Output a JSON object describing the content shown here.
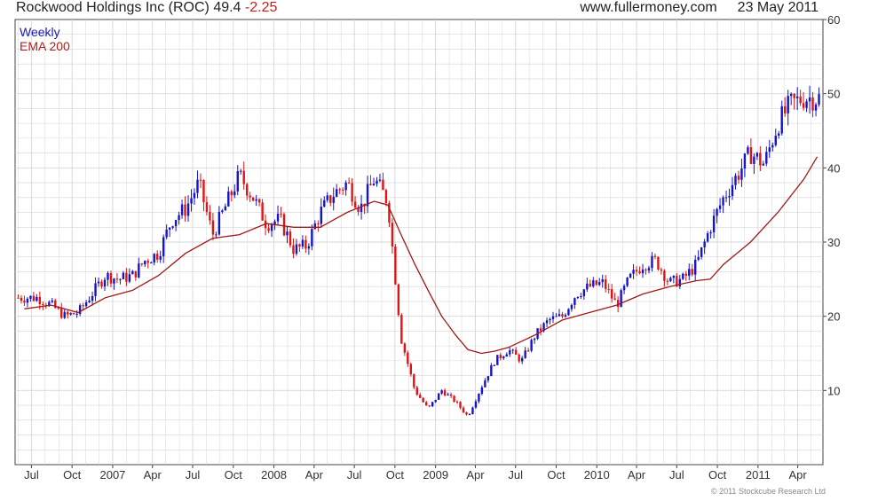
{
  "header": {
    "ticker_name": "Rockwood Holdings Inc (ROC)",
    "last_price": "49.4",
    "change": "-2.25",
    "website": "www.fullermoney.com",
    "date": "23 May 2011"
  },
  "legend": {
    "series_label": "Weekly",
    "ema_label": "EMA 200"
  },
  "credit": "© 2011 Stockcube Research Ltd",
  "colors": {
    "up_candle": "#1414c8",
    "down_candle": "#e01414",
    "ema_line": "#a01818",
    "grid": "#d6d6d6",
    "legend_weekly": "#1a1ab0",
    "legend_ema": "#b02020"
  },
  "chart_data": {
    "type": "line",
    "title": "Rockwood Holdings Inc (ROC) 49.4 -2.25",
    "subtitle": "Weekly",
    "xlabel": "",
    "ylabel": "",
    "ylim": [
      0,
      60
    ],
    "yticks": [
      10,
      20,
      30,
      40,
      50,
      60
    ],
    "x_tick_labels": [
      "Jul",
      "Oct",
      "2007",
      "Apr",
      "Jul",
      "Oct",
      "2008",
      "Apr",
      "Jul",
      "Oct",
      "2009",
      "Apr",
      "Jul",
      "Oct",
      "2010",
      "Apr",
      "Jul",
      "Oct",
      "2011",
      "Apr"
    ],
    "y_axis_side": "right",
    "grid": true,
    "legend_position": "top-left",
    "series": [
      {
        "name": "Weekly",
        "style": "candlestick",
        "x": [
          "2006-06",
          "2006-07",
          "2006-08",
          "2006-09",
          "2006-10",
          "2006-11",
          "2006-12",
          "2007-01",
          "2007-02",
          "2007-03",
          "2007-04",
          "2007-05",
          "2007-06",
          "2007-07",
          "2007-08",
          "2007-09",
          "2007-10",
          "2007-11",
          "2007-12",
          "2008-01",
          "2008-02",
          "2008-03",
          "2008-04",
          "2008-05",
          "2008-06",
          "2008-07",
          "2008-08",
          "2008-09",
          "2008-10",
          "2008-11",
          "2008-12",
          "2009-01",
          "2009-02",
          "2009-03",
          "2009-04",
          "2009-05",
          "2009-06",
          "2009-07",
          "2009-08",
          "2009-09",
          "2009-10",
          "2009-11",
          "2009-12",
          "2010-01",
          "2010-02",
          "2010-03",
          "2010-04",
          "2010-05",
          "2010-06",
          "2010-07",
          "2010-08",
          "2010-09",
          "2010-10",
          "2010-11",
          "2010-12",
          "2011-01",
          "2011-02",
          "2011-03",
          "2011-04",
          "2011-05"
        ],
        "values": [
          22.5,
          22.5,
          21.5,
          20,
          20.5,
          23,
          25.5,
          25,
          25.5,
          27.5,
          28.5,
          33,
          34.5,
          38,
          31,
          35,
          39,
          36,
          32.5,
          33,
          29,
          29.5,
          34,
          36.5,
          38,
          34.5,
          38.5,
          35.5,
          17,
          10,
          7.5,
          10,
          8.5,
          6.5,
          10.5,
          14,
          15.5,
          14,
          17.5,
          19.5,
          20,
          23,
          24,
          24.5,
          21.5,
          25,
          27,
          27.5,
          24.5,
          25,
          27,
          32,
          36,
          39,
          42,
          40.5,
          46,
          48.5,
          49.5,
          49.4
        ]
      },
      {
        "name": "EMA 200",
        "style": "line",
        "x": [
          "2006-06",
          "2006-08",
          "2006-10",
          "2006-12",
          "2007-02",
          "2007-04",
          "2007-06",
          "2007-08",
          "2007-10",
          "2007-12",
          "2008-02",
          "2008-04",
          "2008-06",
          "2008-08",
          "2008-09",
          "2008-10",
          "2008-11",
          "2008-12",
          "2009-01",
          "2009-02",
          "2009-03",
          "2009-04",
          "2009-05",
          "2009-06",
          "2009-08",
          "2009-10",
          "2009-12",
          "2010-02",
          "2010-04",
          "2010-06",
          "2010-08",
          "2010-09",
          "2010-10",
          "2010-12",
          "2011-02",
          "2011-04",
          "2011-05"
        ],
        "values": [
          21,
          21.5,
          20.5,
          22.5,
          23.5,
          25.5,
          28.5,
          30.5,
          31,
          32.5,
          32,
          32,
          34,
          35.5,
          35,
          31,
          27,
          23.5,
          20,
          17.5,
          15.5,
          15,
          15.3,
          15.8,
          17.5,
          19.5,
          20.5,
          21.5,
          23,
          24,
          24.8,
          25,
          27,
          30,
          34,
          38.5,
          41.5
        ]
      }
    ]
  }
}
